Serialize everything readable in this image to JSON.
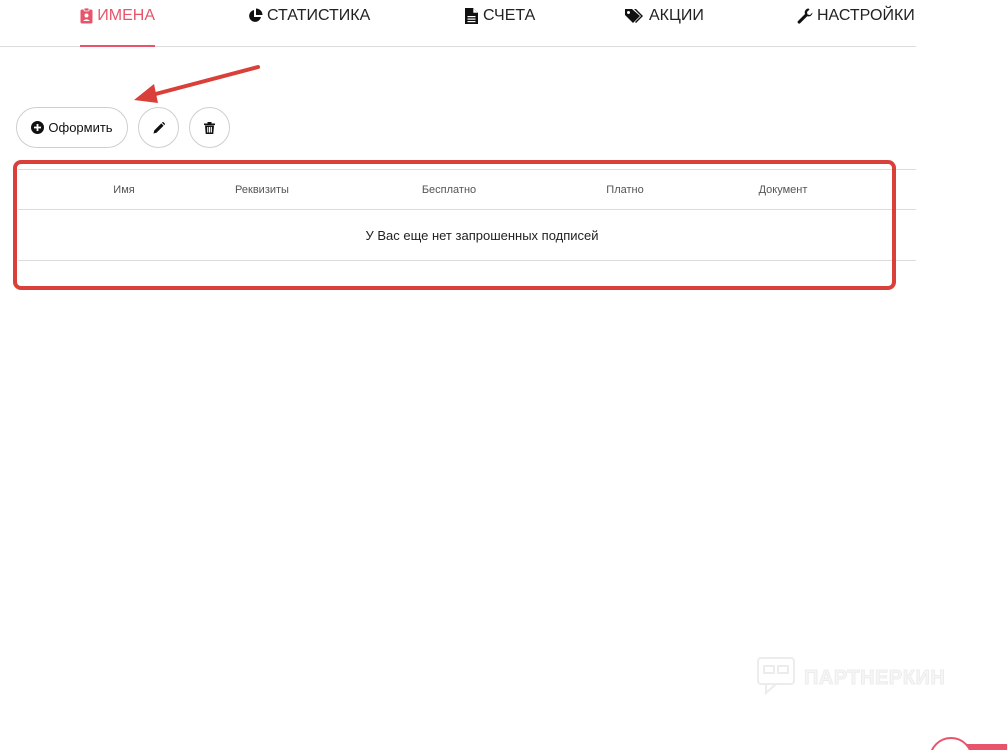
{
  "tabs": [
    {
      "label": "ИМЕНА",
      "icon": "id-badge-icon",
      "active": true
    },
    {
      "label": "СТАТИСТИКА",
      "icon": "pie-chart-icon",
      "active": false
    },
    {
      "label": "СЧЕТА",
      "icon": "document-icon",
      "active": false
    },
    {
      "label": "АКЦИИ",
      "icon": "tags-icon",
      "active": false
    },
    {
      "label": "НАСТРОЙКИ",
      "icon": "wrench-icon",
      "active": false
    }
  ],
  "toolbar": {
    "create_label": "Оформить",
    "create_icon": "plus-circle-icon",
    "edit_icon": "pencil-icon",
    "delete_icon": "trash-icon"
  },
  "table": {
    "columns": [
      "Имя",
      "Реквизиты",
      "Бесплатно",
      "Платно",
      "Документ"
    ],
    "empty_message": "У Вас еще нет запрошенных подписей"
  },
  "watermark": {
    "text": "ПАРТНЕРКИН"
  },
  "colors": {
    "accent": "#e8546b",
    "annotation": "#d9403a",
    "border": "#dcdcdc"
  }
}
